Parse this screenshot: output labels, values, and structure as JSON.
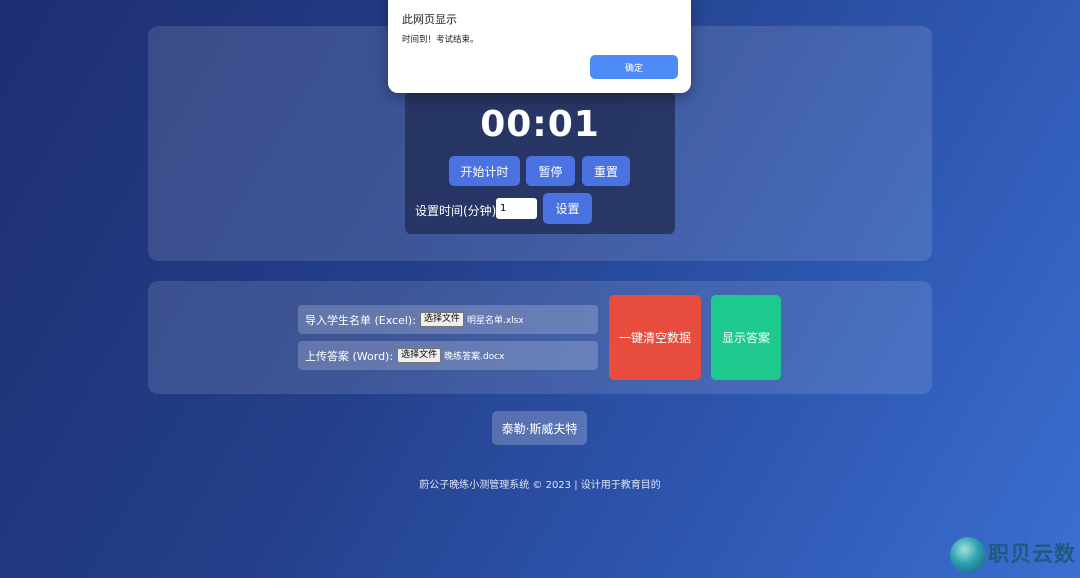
{
  "timer": {
    "display": "00:01",
    "start_label": "开始计时",
    "pause_label": "暂停",
    "reset_label": "重置",
    "set_time_label": "设置时间(分钟):",
    "minutes_value": "1",
    "set_label": "设置"
  },
  "import": {
    "excel_label": "导入学生名单 (Excel):",
    "excel_button": "选择文件",
    "excel_file": "明星名单.xlsx",
    "word_label": "上传答案 (Word):",
    "word_button": "选择文件",
    "word_file": "晚练答案.docx",
    "clear_label": "一键清空数据",
    "answer_label": "显示答案",
    "colors": {
      "clear": "#e74c3c",
      "answer": "#1ec98d"
    }
  },
  "student": {
    "name": "泰勒·斯威夫特"
  },
  "footer": {
    "text": "蔚公子晚练小测管理系统 © 2023 | 设计用于教育目的"
  },
  "dialog": {
    "title": "此网页显示",
    "message": "时间到！考试结束。",
    "ok_label": "确定"
  },
  "watermark": {
    "text": "职贝云数",
    "icon": "globe-logo-icon"
  }
}
